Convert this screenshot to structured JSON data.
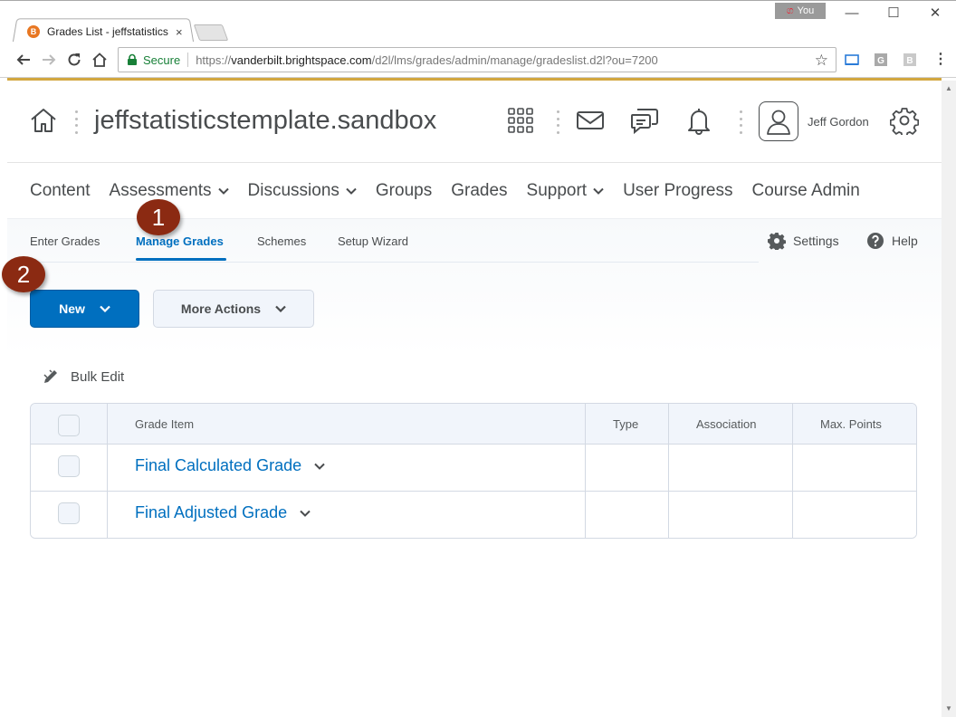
{
  "browser": {
    "tab_title": "Grades List - jeffstatistics",
    "tab_close": "×",
    "profile_label": "You",
    "win_min": "—",
    "win_max": "☐",
    "win_close": "✕",
    "secure_label": "Secure",
    "url_scheme": "https://",
    "url_host": "vanderbilt.brightspace.com",
    "url_path": "/d2l/lms/grades/admin/manage/gradeslist.d2l?ou=7200",
    "star": "☆",
    "menu": "⋮",
    "icons": [
      "back-icon",
      "forward-icon",
      "reload-icon",
      "home-icon",
      "lock-icon",
      "star-icon",
      "cast-icon",
      "extension-g-icon",
      "extension-b-icon",
      "menu-icon"
    ]
  },
  "header": {
    "course_title": "jeffstatisticstemplate.sandbox",
    "user_name": "Jeff Gordon",
    "icons": [
      "home-icon",
      "waffle-icon",
      "mail-icon",
      "chat-icon",
      "bell-icon",
      "avatar-icon",
      "gear-icon"
    ]
  },
  "nav": {
    "items": [
      {
        "label": "Content",
        "dropdown": false
      },
      {
        "label": "Assessments",
        "dropdown": true
      },
      {
        "label": "Discussions",
        "dropdown": true
      },
      {
        "label": "Groups",
        "dropdown": false
      },
      {
        "label": "Grades",
        "dropdown": false
      },
      {
        "label": "Support",
        "dropdown": true
      },
      {
        "label": "User Progress",
        "dropdown": false
      },
      {
        "label": "Course Admin",
        "dropdown": false
      }
    ]
  },
  "subnav": {
    "items": [
      "Enter Grades",
      "Manage Grades",
      "Schemes",
      "Setup Wizard"
    ],
    "active": "Manage Grades",
    "settings": "Settings",
    "help": "Help"
  },
  "actions": {
    "new_label": "New",
    "more_label": "More Actions",
    "bulk_edit": "Bulk Edit"
  },
  "table": {
    "columns": [
      "",
      "Grade Item",
      "Type",
      "Association",
      "Max. Points"
    ],
    "rows": [
      {
        "item": "Final Calculated Grade",
        "type": "",
        "association": "",
        "max_points": ""
      },
      {
        "item": "Final Adjusted Grade",
        "type": "",
        "association": "",
        "max_points": ""
      }
    ]
  },
  "callouts": [
    "1",
    "2"
  ],
  "colors": {
    "brand_blue": "#006fbf",
    "gold_bar": "#d2a740",
    "callout": "#8b2a12",
    "text": "#494c4e"
  }
}
